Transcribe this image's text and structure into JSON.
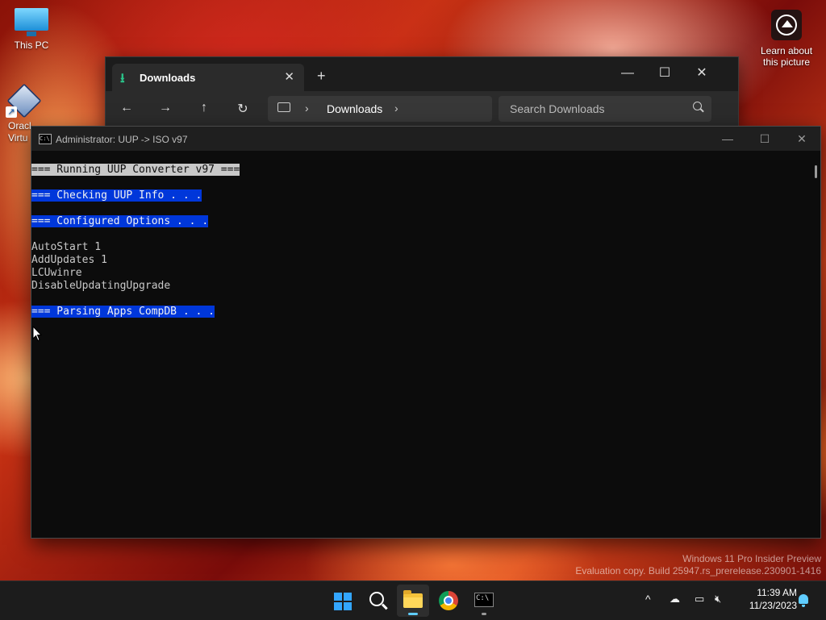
{
  "desktop": {
    "icons": [
      {
        "label": "This PC",
        "icon": "monitor-icon"
      },
      {
        "label": "Oracl\nVirtu",
        "icon": "virtualbox-icon"
      }
    ],
    "learn_picture": {
      "label": "Learn about this picture",
      "icon": "camera-icon"
    }
  },
  "explorer": {
    "tab_label": "Downloads",
    "tab_icon": "download-icon",
    "new_tab_glyph": "+",
    "tab_close_glyph": "✕",
    "controls": {
      "minimize": "—",
      "maximize": "☐",
      "close": "✕"
    },
    "nav": {
      "back": "←",
      "forward": "→",
      "up": "↑",
      "refresh": "↻"
    },
    "address": {
      "crumb": "Downloads",
      "chevron": "›"
    },
    "search": {
      "placeholder": "Search Downloads"
    }
  },
  "cmd": {
    "title": "Administrator:  UUP -> ISO v97",
    "icon_text": "C:\\",
    "controls": {
      "minimize": "—",
      "maximize": "☐",
      "close": "✕"
    },
    "lines": [
      {
        "text": "=== Running UUP Converter v97 ===",
        "style": "gray"
      },
      {
        "text": "",
        "style": "none"
      },
      {
        "text": "=== Checking UUP Info . . .",
        "style": "blue"
      },
      {
        "text": "",
        "style": "none"
      },
      {
        "text": "=== Configured Options . . .",
        "style": "blue"
      },
      {
        "text": "",
        "style": "none"
      },
      {
        "text": "AutoStart 1",
        "style": "none"
      },
      {
        "text": "AddUpdates 1",
        "style": "none"
      },
      {
        "text": "LCUwinre",
        "style": "none"
      },
      {
        "text": "DisableUpdatingUpgrade",
        "style": "none"
      },
      {
        "text": "",
        "style": "none"
      },
      {
        "text": "=== Parsing Apps CompDB . . .",
        "style": "blue"
      }
    ]
  },
  "watermark": {
    "line1": "Windows 11 Pro Insider Preview",
    "line2": "Evaluation copy. Build 25947.rs_prerelease.230901-1416"
  },
  "taskbar": {
    "apps": [
      "start-icon",
      "search-icon",
      "file-explorer-icon",
      "chrome-icon",
      "terminal-icon"
    ],
    "tray": {
      "chevron": "^"
    },
    "clock": {
      "time": "11:39 AM",
      "date": "11/23/2023"
    }
  },
  "colors": {
    "cmd_highlight_blue": "#0037da",
    "cmd_highlight_gray": "#c8c8c8",
    "accent": "#60cdff"
  }
}
